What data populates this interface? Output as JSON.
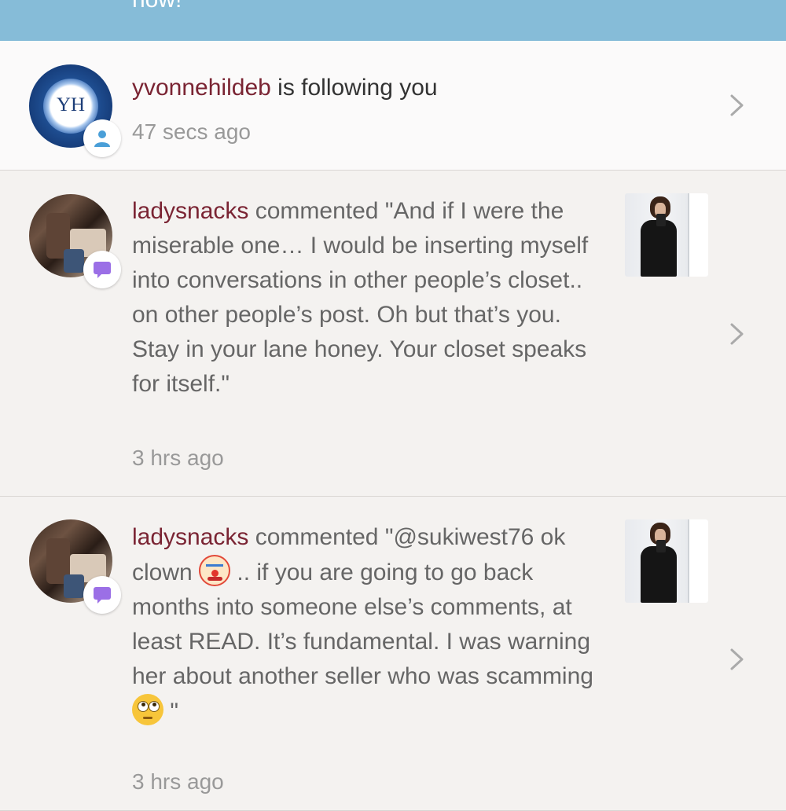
{
  "banner": {
    "text": "now!"
  },
  "notifications": [
    {
      "type": "follow",
      "avatar_initials": "YH",
      "username": "yvonnehildeb",
      "action": " is following you",
      "time": "47 secs ago",
      "badge_icon": "person-icon"
    },
    {
      "type": "comment",
      "username": "ladysnacks",
      "verb": " commented ",
      "comment": "\"And if I were the miserable one… I would be inserting myself into conversations in other people’s closet.. on other people’s post. Oh but that’s you. Stay in your lane honey. Your closet speaks for itself.\"",
      "time": "3 hrs ago",
      "badge_icon": "comment-bubble-icon"
    },
    {
      "type": "comment",
      "username": "ladysnacks",
      "verb": " commented ",
      "comment_part1": "\"@sukiwest76 ok clown ",
      "emoji1": "clown-face-emoji",
      "comment_part2": " .. if you are going to go back months into someone else’s comments, at least READ. It’s fundamental. I was warning her about another seller who was scamming ",
      "emoji2": "eye-roll-emoji",
      "comment_part3": " \"",
      "time": "3 hrs ago",
      "badge_icon": "comment-bubble-icon"
    }
  ],
  "colors": {
    "banner": "#86bcd8",
    "username": "#7a2433",
    "badge_person": "#4a9fd8",
    "badge_comment": "#9b6fe6"
  }
}
